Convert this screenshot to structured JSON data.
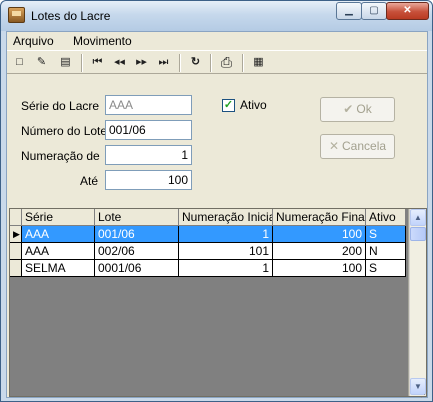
{
  "window": {
    "title": "Lotes do Lacre"
  },
  "menu": [
    "Arquivo",
    "Movimento"
  ],
  "toolbar": {
    "new_icon": "□",
    "edit_icon": "✎",
    "delete_icon": "▤",
    "first_icon": "⏮",
    "prev_icon": "◀◀",
    "next_icon": "▶▶",
    "last_icon": "⏭",
    "refresh_icon": "↻",
    "print_icon": "⎙",
    "settings_icon": "▦"
  },
  "form": {
    "serie_label": "Série do Lacre",
    "serie_value": "AAA",
    "lote_label": "Número do Lote",
    "lote_value": "001/06",
    "num_de_label": "Numeração de",
    "num_de_value": "1",
    "ate_label": "Até",
    "ate_value": "100",
    "ativo_label": "Ativo",
    "ativo_checked": "✓"
  },
  "buttons": {
    "ok": "Ok",
    "cancel": "Cancela"
  },
  "table": {
    "columns": [
      "Série",
      "Lote",
      "Numeração Inicial",
      "Numeração Final",
      "Ativo"
    ],
    "rows": [
      {
        "serie": "AAA",
        "lote": "001/06",
        "inicial": "1",
        "final": "100",
        "ativo": "S"
      },
      {
        "serie": "AAA",
        "lote": "002/06",
        "inicial": "101",
        "final": "200",
        "ativo": "N"
      },
      {
        "serie": "SELMA",
        "lote": "0001/06",
        "inicial": "1",
        "final": "100",
        "ativo": "S"
      }
    ]
  },
  "colors": {
    "selection": "#3399ff",
    "face": "#ece9d8",
    "close": "#c7503a"
  }
}
